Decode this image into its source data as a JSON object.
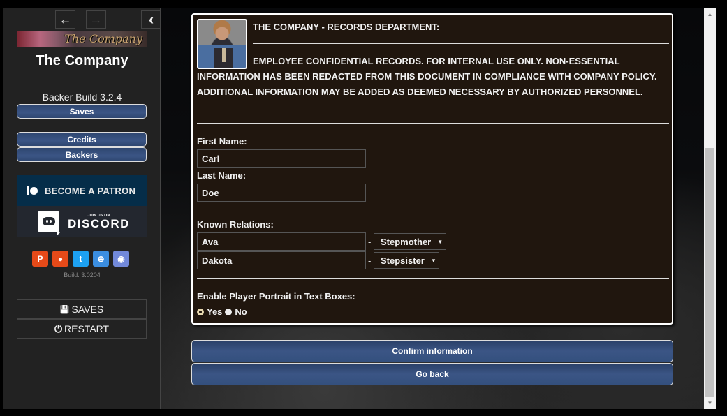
{
  "sidebar": {
    "nav": {
      "back_icon": "←",
      "forward_icon": "→",
      "collapse_icon": "‹"
    },
    "banner_text": "The Company",
    "story_title": "The Company",
    "build_label": "Backer Build 3.2.4",
    "buttons": {
      "saves": "Saves",
      "credits": "Credits",
      "backers": "Backers"
    },
    "patreon_banner": "BECOME A PATRON",
    "discord_banner": {
      "small": "JOIN US ON",
      "big": "DISCORD"
    },
    "social_icons": [
      {
        "name": "patreon-icon",
        "glyph": "P",
        "color": "#e64a19"
      },
      {
        "name": "reddit-icon",
        "glyph": "●",
        "color": "#e64a19"
      },
      {
        "name": "twitter-icon",
        "glyph": "t",
        "color": "#1da1f2"
      },
      {
        "name": "globe-icon",
        "glyph": "⊕",
        "color": "#3b8ee0"
      },
      {
        "name": "discord-icon",
        "glyph": "◉",
        "color": "#7289da"
      }
    ],
    "build_number": "Build: 3.0204",
    "menu": {
      "saves": {
        "icon": "💾",
        "label": "SAVES"
      },
      "restart": {
        "icon": "⏻",
        "label": "RESTART"
      }
    }
  },
  "record": {
    "title": "THE COMPANY - RECORDS DEPARTMENT:",
    "notice": "EMPLOYEE CONFIDENTIAL RECORDS. FOR INTERNAL USE ONLY. NON-ESSENTIAL INFORMATION HAS BEEN REDACTED FROM THIS DOCUMENT IN COMPLIANCE WITH COMPANY POLICY. ADDITIONAL INFORMATION MAY BE ADDED AS DEEMED NECESSARY BY AUTHORIZED PERSONNEL.",
    "first_name_label": "First Name:",
    "first_name_value": "Carl",
    "last_name_label": "Last Name:",
    "last_name_value": "Doe",
    "relations_label": "Known Relations:",
    "relations": [
      {
        "name": "Ava",
        "relation": "Stepmother"
      },
      {
        "name": "Dakota",
        "relation": "Stepsister"
      }
    ],
    "separator": "-",
    "caret": "▼",
    "portrait_label": "Enable Player Portrait in Text Boxes:",
    "portrait_options": [
      {
        "label": "Yes",
        "selected": true
      },
      {
        "label": "No",
        "selected": false
      }
    ]
  },
  "actions": {
    "confirm": "Confirm information",
    "back": "Go back"
  },
  "scrollbar": {
    "up_icon": "▲",
    "down_icon": "▼"
  }
}
